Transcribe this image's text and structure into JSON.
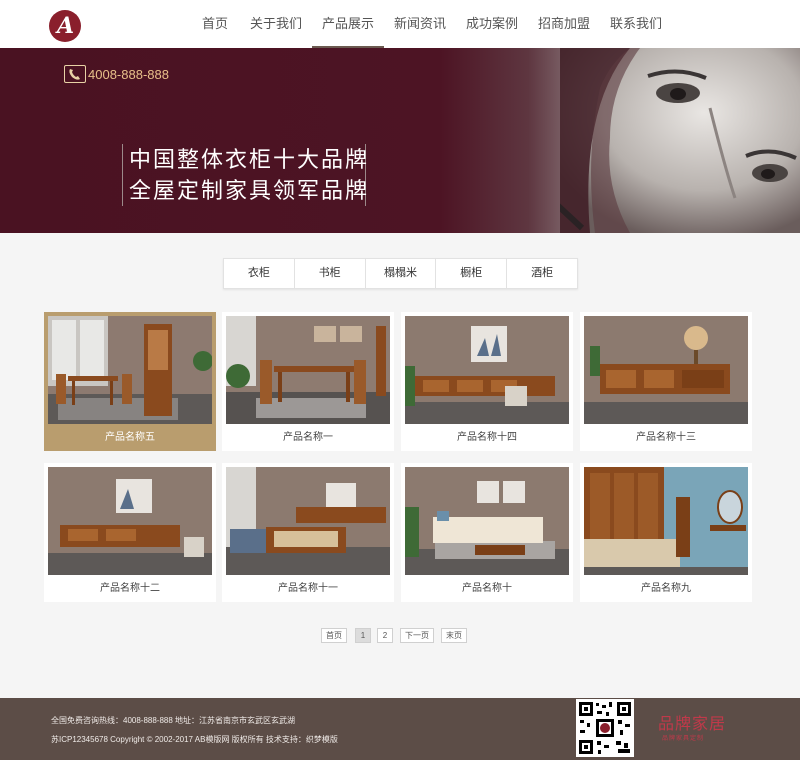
{
  "header": {
    "logo_letter": "A",
    "nav": [
      {
        "label": "首页",
        "active": false
      },
      {
        "label": "关于我们",
        "active": false
      },
      {
        "label": "产品展示",
        "active": true
      },
      {
        "label": "新闻资讯",
        "active": false
      },
      {
        "label": "成功案例",
        "active": false
      },
      {
        "label": "招商加盟",
        "active": false
      },
      {
        "label": "联系我们",
        "active": false
      }
    ]
  },
  "banner": {
    "phone": "4008-888-888",
    "slogan_line1": "中国整体衣柜十大品牌",
    "slogan_line2": "全屋定制家具领军品牌"
  },
  "categories": [
    "衣柜",
    "书柜",
    "榻榻米",
    "橱柜",
    "酒柜"
  ],
  "products": [
    {
      "name": "产品名称五",
      "scene": "dining",
      "active": true
    },
    {
      "name": "产品名称一",
      "scene": "dining",
      "active": false
    },
    {
      "name": "产品名称十四",
      "scene": "tv",
      "active": false
    },
    {
      "name": "产品名称十三",
      "scene": "tv",
      "active": false
    },
    {
      "name": "产品名称十二",
      "scene": "tv",
      "active": false
    },
    {
      "name": "产品名称十一",
      "scene": "living",
      "active": false
    },
    {
      "name": "产品名称十",
      "scene": "living",
      "active": false
    },
    {
      "name": "产品名称九",
      "scene": "bedroom",
      "active": false
    }
  ],
  "pagination": {
    "first": "首页",
    "pages": [
      "1",
      "2"
    ],
    "current": "1",
    "next": "下一页",
    "last": "末页"
  },
  "footer": {
    "hotline_line": "全国免费咨询热线：4008-888-888 地址：江苏省南京市玄武区玄武湖",
    "copyright_line": "苏ICP12345678 Copyright © 2002-2017 AB模版网 版权所有 技术支持：织梦模版",
    "brand_title": "品牌家居",
    "brand_sub": "品牌家具定制"
  },
  "colors": {
    "banner": "#4a1222",
    "accent_gold": "#b99d6e",
    "footer": "#5c4d47",
    "logo": "#8a1f2c"
  }
}
